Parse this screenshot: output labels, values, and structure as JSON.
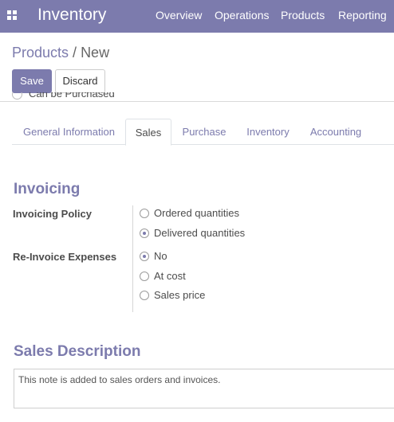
{
  "app": {
    "title": "Inventory"
  },
  "nav": {
    "items": [
      {
        "label": "Overview"
      },
      {
        "label": "Operations"
      },
      {
        "label": "Products"
      },
      {
        "label": "Reporting"
      }
    ]
  },
  "breadcrumb": {
    "parent": "Products",
    "separator": "/",
    "current": "New"
  },
  "toolbar": {
    "save_label": "Save",
    "discard_label": "Discard"
  },
  "clipped_field": {
    "label": "Can be Purchased"
  },
  "tabs": [
    {
      "label": "General Information",
      "active": false
    },
    {
      "label": "Sales",
      "active": true
    },
    {
      "label": "Purchase",
      "active": false
    },
    {
      "label": "Inventory",
      "active": false
    },
    {
      "label": "Accounting",
      "active": false
    }
  ],
  "invoicing": {
    "title": "Invoicing",
    "policy": {
      "label": "Invoicing Policy",
      "options": [
        {
          "label": "Ordered quantities",
          "checked": false
        },
        {
          "label": "Delivered quantities",
          "checked": true
        }
      ]
    },
    "reinvoice": {
      "label": "Re-Invoice Expenses",
      "options": [
        {
          "label": "No",
          "checked": true
        },
        {
          "label": "At cost",
          "checked": false
        },
        {
          "label": "Sales price",
          "checked": false
        }
      ]
    }
  },
  "sales_description": {
    "title": "Sales Description",
    "value": "This note is added to sales orders and invoices."
  },
  "colors": {
    "brand": "#7c7bad",
    "text": "#4c4c4c",
    "border": "#dee2e6"
  }
}
